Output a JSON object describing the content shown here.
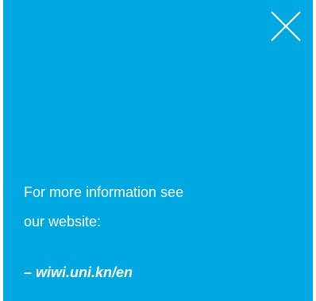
{
  "colors": {
    "panel_background": "#00a8e1",
    "text": "#ffffff"
  },
  "close_button": {
    "icon": "close-icon"
  },
  "info": {
    "line1": "For more information see",
    "line2": "our website:"
  },
  "website_link": {
    "label": "– wiwi.uni.kn/en"
  }
}
